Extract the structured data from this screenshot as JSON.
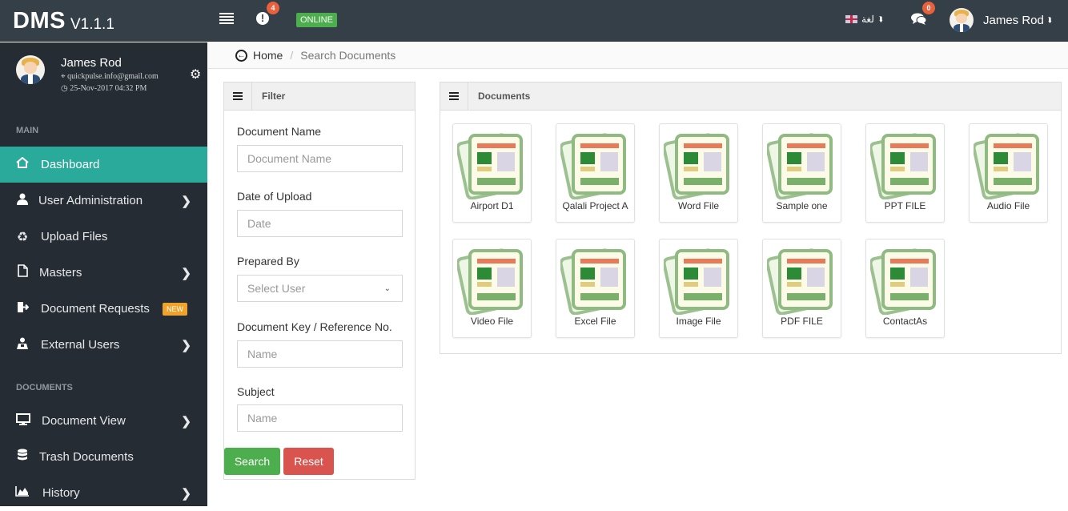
{
  "topbar": {
    "brand_title": "DMS",
    "brand_version": "V1.1.1",
    "alert_count": "4",
    "alert_icon": "!",
    "status": "ONLINE",
    "language_label": "لغة",
    "messages_count": "0",
    "user_name": "James Rod",
    "dropdown_glyph": "»"
  },
  "sidebar": {
    "profile": {
      "name": "James Rod",
      "email": "quickpulse.info@gmail.com",
      "datetime": "25-Nov-2017 04:32 PM"
    },
    "sections": [
      {
        "label": "MAIN",
        "items": [
          {
            "label": "Dashboard",
            "icon": "home-icon",
            "active": true
          },
          {
            "label": "User Administration",
            "icon": "user-icon",
            "has_submenu": true
          },
          {
            "label": "Upload Files",
            "icon": "recycle-icon"
          },
          {
            "label": "Masters",
            "icon": "file-icon",
            "has_submenu": true
          },
          {
            "label": "Document Requests",
            "icon": "sign-out-icon",
            "badge": "NEW"
          },
          {
            "label": "External Users",
            "icon": "users-icon",
            "has_submenu": true
          }
        ]
      },
      {
        "label": "DOCUMENTS",
        "items": [
          {
            "label": "Document View",
            "icon": "monitor-icon",
            "has_submenu": true
          },
          {
            "label": "Trash Documents",
            "icon": "database-icon"
          },
          {
            "label": "History",
            "icon": "area-chart-icon",
            "has_submenu": true
          }
        ]
      }
    ]
  },
  "breadcrumb": {
    "home": "Home",
    "separator": "/",
    "current": "Search Documents"
  },
  "filter": {
    "title": "Filter",
    "fields": [
      {
        "label": "Document Name",
        "placeholder": "Document Name",
        "value": ""
      },
      {
        "label": "Date of Upload",
        "placeholder": "Date",
        "value": ""
      },
      {
        "label": "Prepared By",
        "selected": "Select User"
      },
      {
        "label": "Document Key / Reference No.",
        "placeholder": "Name",
        "value": ""
      },
      {
        "label": "Subject",
        "placeholder": "Name",
        "value": ""
      }
    ],
    "search_label": "Search",
    "reset_label": "Reset"
  },
  "documents": {
    "title": "Documents",
    "items": [
      {
        "name": "Airport D1"
      },
      {
        "name": "Qalali Project A"
      },
      {
        "name": "Word File"
      },
      {
        "name": "Sample one"
      },
      {
        "name": "PPT FILE"
      },
      {
        "name": "Audio File"
      },
      {
        "name": "Video File"
      },
      {
        "name": "Excel File"
      },
      {
        "name": "Image File"
      },
      {
        "name": "PDF FILE"
      },
      {
        "name": "ContactAs"
      }
    ]
  },
  "colors": {
    "topbar_bg": "#343f47",
    "sidebar_bg": "#262c33",
    "active_item": "#2aaa9b",
    "online_badge": "#4cae4c",
    "search_button": "#4cae4c",
    "reset_button": "#d9534f",
    "new_badge": "#f0a32a",
    "count_badge": "#e8603c"
  }
}
